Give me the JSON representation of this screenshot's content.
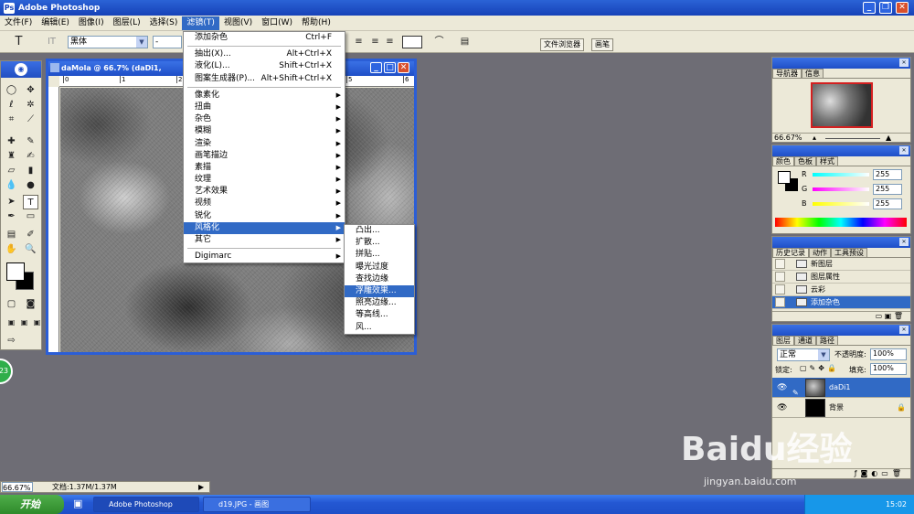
{
  "window": {
    "title": "Adobe Photoshop"
  },
  "menubar": [
    "文件(F)",
    "编辑(E)",
    "图像(I)",
    "图层(L)",
    "选择(S)",
    "滤镜(T)",
    "视图(V)",
    "窗口(W)",
    "帮助(H)"
  ],
  "options": {
    "font_family": "黑体",
    "font_style": "-",
    "palettes_tab": "文件浏览器",
    "brushes_tab": "画笔"
  },
  "document": {
    "title": "daMola @ 66.7% (daDi1,",
    "ruler_labels": [
      "0",
      "1",
      "2",
      "3",
      "4",
      "5",
      "6"
    ]
  },
  "filter_menu": {
    "items": [
      {
        "label": "添加杂色",
        "shortcut": "Ctrl+F"
      },
      {
        "sep": true
      },
      {
        "label": "抽出(X)...",
        "shortcut": "Alt+Ctrl+X"
      },
      {
        "label": "液化(L)...",
        "shortcut": "Shift+Ctrl+X"
      },
      {
        "label": "图案生成器(P)...",
        "shortcut": "Alt+Shift+Ctrl+X"
      },
      {
        "sep": true
      },
      {
        "label": "像素化",
        "sub": true
      },
      {
        "label": "扭曲",
        "sub": true
      },
      {
        "label": "杂色",
        "sub": true
      },
      {
        "label": "模糊",
        "sub": true
      },
      {
        "label": "渲染",
        "sub": true
      },
      {
        "label": "画笔描边",
        "sub": true
      },
      {
        "label": "素描",
        "sub": true
      },
      {
        "label": "纹理",
        "sub": true
      },
      {
        "label": "艺术效果",
        "sub": true
      },
      {
        "label": "视频",
        "sub": true
      },
      {
        "label": "锐化",
        "sub": true
      },
      {
        "label": "风格化",
        "sub": true,
        "hl": true
      },
      {
        "label": "其它",
        "sub": true
      },
      {
        "sep": true
      },
      {
        "label": "Digimarc",
        "sub": true
      }
    ]
  },
  "stylize_menu": {
    "items": [
      {
        "label": "凸出..."
      },
      {
        "label": "扩散..."
      },
      {
        "label": "拼贴..."
      },
      {
        "label": "曝光过度"
      },
      {
        "label": "查找边缘"
      },
      {
        "label": "浮雕效果...",
        "hl": true
      },
      {
        "label": "照亮边缘..."
      },
      {
        "label": "等高线..."
      },
      {
        "label": "风..."
      }
    ]
  },
  "navigator": {
    "tabs": [
      "导航器",
      "信息"
    ],
    "zoom": "66.67%"
  },
  "color": {
    "tabs": [
      "颜色",
      "色板",
      "样式"
    ],
    "r_label": "R",
    "g_label": "G",
    "b_label": "B",
    "r": "255",
    "g": "255",
    "b": "255"
  },
  "history": {
    "tabs": [
      "历史记录",
      "动作",
      "工具预设"
    ],
    "items": [
      "新图层",
      "图层属性",
      "云彩",
      "添加杂色"
    ]
  },
  "layers": {
    "tabs": [
      "图层",
      "通道",
      "路径"
    ],
    "blend": "正常",
    "opacity_label": "不透明度:",
    "opacity": "100%",
    "lock_label": "锁定:",
    "fill_label": "填充:",
    "fill": "100%",
    "rows": [
      "daDi1",
      "背景"
    ]
  },
  "status": {
    "zoom": "66.67%",
    "doc": "文档:1.37M/1.37M"
  },
  "taskbar": {
    "start": "开始",
    "tasks": [
      "Adobe Photoshop",
      "d19.JPG - 画图"
    ],
    "clock": "15:02"
  },
  "watermark": {
    "brand": "Baidu经验",
    "url": "jingyan.baidu.com"
  },
  "badge": "23"
}
